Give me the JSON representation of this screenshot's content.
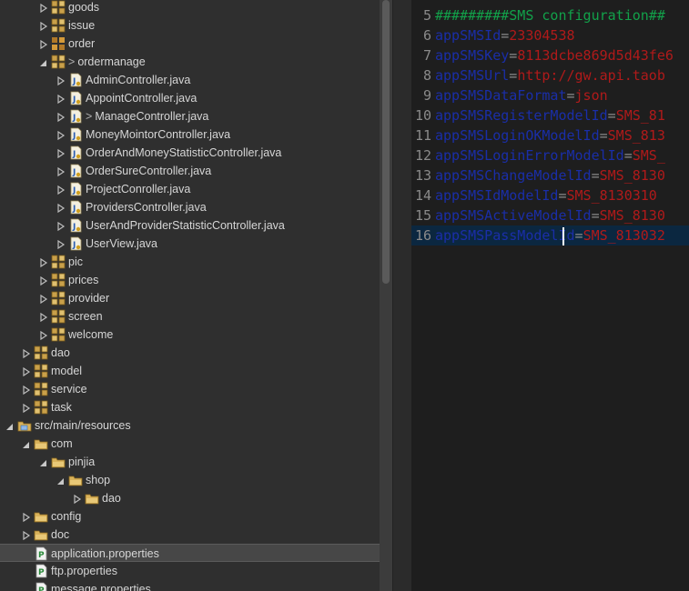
{
  "explorer": {
    "rows": [
      {
        "label": "goods",
        "type": "package",
        "indent": 2,
        "arrow": "collapsed"
      },
      {
        "label": "issue",
        "type": "package",
        "indent": 2,
        "arrow": "collapsed"
      },
      {
        "label": "order",
        "type": "package-plain",
        "indent": 2,
        "arrow": "collapsed"
      },
      {
        "label": "ordermanage",
        "type": "package",
        "indent": 2,
        "arrow": "expanded",
        "prefix": ">"
      },
      {
        "label": "AdminController.java",
        "type": "java",
        "indent": 3,
        "arrow": "collapsed"
      },
      {
        "label": "AppointController.java",
        "type": "java",
        "indent": 3,
        "arrow": "collapsed"
      },
      {
        "label": "ManageController.java",
        "type": "java",
        "indent": 3,
        "arrow": "collapsed",
        "prefix": ">"
      },
      {
        "label": "MoneyMointorController.java",
        "type": "java",
        "indent": 3,
        "arrow": "collapsed"
      },
      {
        "label": "OrderAndMoneyStatisticController.java",
        "type": "java",
        "indent": 3,
        "arrow": "collapsed"
      },
      {
        "label": "OrderSureController.java",
        "type": "java",
        "indent": 3,
        "arrow": "collapsed"
      },
      {
        "label": "ProjectConroller.java",
        "type": "java",
        "indent": 3,
        "arrow": "collapsed"
      },
      {
        "label": "ProvidersController.java",
        "type": "java",
        "indent": 3,
        "arrow": "collapsed"
      },
      {
        "label": "UserAndProviderStatisticController.java",
        "type": "java",
        "indent": 3,
        "arrow": "collapsed"
      },
      {
        "label": "UserView.java",
        "type": "java",
        "indent": 3,
        "arrow": "collapsed"
      },
      {
        "label": "pic",
        "type": "package",
        "indent": 2,
        "arrow": "collapsed"
      },
      {
        "label": "prices",
        "type": "package",
        "indent": 2,
        "arrow": "collapsed"
      },
      {
        "label": "provider",
        "type": "package",
        "indent": 2,
        "arrow": "collapsed"
      },
      {
        "label": "screen",
        "type": "package",
        "indent": 2,
        "arrow": "collapsed"
      },
      {
        "label": "welcome",
        "type": "package",
        "indent": 2,
        "arrow": "collapsed"
      },
      {
        "label": "dao",
        "type": "package",
        "indent": 1,
        "arrow": "collapsed"
      },
      {
        "label": "model",
        "type": "package",
        "indent": 1,
        "arrow": "collapsed"
      },
      {
        "label": "service",
        "type": "package",
        "indent": 1,
        "arrow": "collapsed"
      },
      {
        "label": "task",
        "type": "package",
        "indent": 1,
        "arrow": "collapsed"
      },
      {
        "label": "src/main/resources",
        "type": "source-folder",
        "indent": 0,
        "arrow": "expanded"
      },
      {
        "label": "com",
        "type": "folder",
        "indent": 1,
        "arrow": "expanded"
      },
      {
        "label": "pinjia",
        "type": "folder",
        "indent": 2,
        "arrow": "expanded"
      },
      {
        "label": "shop",
        "type": "folder",
        "indent": 3,
        "arrow": "expanded"
      },
      {
        "label": "dao",
        "type": "folder",
        "indent": 4,
        "arrow": "collapsed"
      },
      {
        "label": "config",
        "type": "folder",
        "indent": 1,
        "arrow": "collapsed"
      },
      {
        "label": "doc",
        "type": "folder",
        "indent": 1,
        "arrow": "collapsed"
      },
      {
        "label": "application.properties",
        "type": "properties",
        "indent": 1,
        "arrow": "none",
        "selected": true
      },
      {
        "label": "ftp.properties",
        "type": "properties",
        "indent": 1,
        "arrow": "none"
      },
      {
        "label": "message.properties",
        "type": "properties",
        "indent": 1,
        "arrow": "none"
      }
    ]
  },
  "editor": {
    "lines": [
      {
        "n": "5",
        "comment": "#########SMS configuration##"
      },
      {
        "n": "6",
        "key": "appSMSId",
        "value": "23304538"
      },
      {
        "n": "7",
        "key": "appSMSKey",
        "value": "8113dcbe869d5d43fe6"
      },
      {
        "n": "8",
        "key": "appSMSUrl",
        "value": "http://gw.api.taob"
      },
      {
        "n": "9",
        "key": "appSMSDataFormat",
        "value": "json"
      },
      {
        "n": "10",
        "key": "appSMSRegisterModelId",
        "value": "SMS_81"
      },
      {
        "n": "11",
        "key": "appSMSLoginOKModelId",
        "value": "SMS_813"
      },
      {
        "n": "12",
        "key": "appSMSLoginErrorModelId",
        "value": "SMS_"
      },
      {
        "n": "13",
        "key": "appSMSChangeModelId",
        "value": "SMS_8130"
      },
      {
        "n": "14",
        "key": "appSMSIdModelId",
        "value": "SMS_8130310"
      },
      {
        "n": "15",
        "key": "appSMSActiveModelId",
        "value": "SMS_8130"
      },
      {
        "n": "16",
        "key": "appSMSPassModelId",
        "value": "SMS_813032",
        "current": true
      }
    ]
  },
  "colors": {
    "key": "#1a2ea8",
    "value": "#b01a1a",
    "comment": "#12a14a",
    "line_number": "#8a8a8a",
    "selection": "#474747"
  }
}
